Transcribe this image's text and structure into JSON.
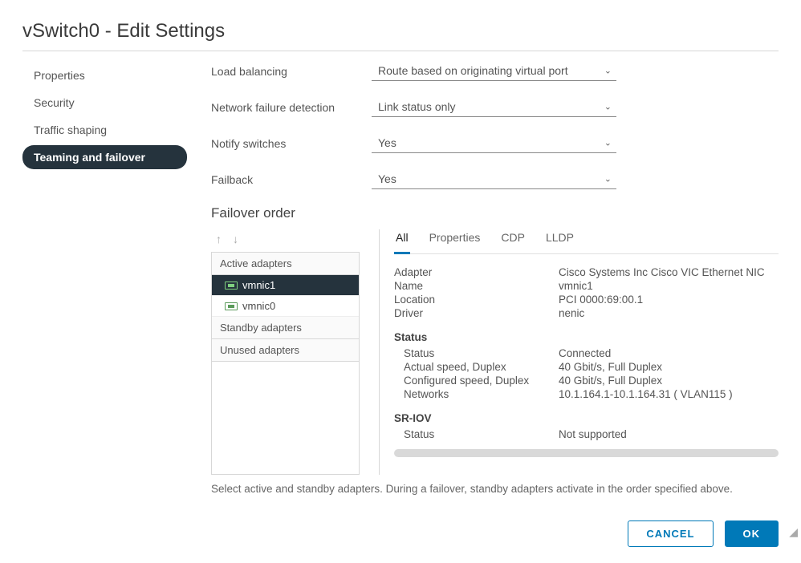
{
  "dialog": {
    "title": "vSwitch0 - Edit Settings"
  },
  "sidebar": {
    "items": [
      {
        "label": "Properties"
      },
      {
        "label": "Security"
      },
      {
        "label": "Traffic shaping"
      },
      {
        "label": "Teaming and failover"
      }
    ]
  },
  "form": {
    "load_balancing": {
      "label": "Load balancing",
      "value": "Route based on originating virtual port"
    },
    "failure_detection": {
      "label": "Network failure detection",
      "value": "Link status only"
    },
    "notify_switches": {
      "label": "Notify switches",
      "value": "Yes"
    },
    "failback": {
      "label": "Failback",
      "value": "Yes"
    }
  },
  "failover": {
    "heading": "Failover order",
    "groups": {
      "active": "Active adapters",
      "standby": "Standby adapters",
      "unused": "Unused adapters"
    },
    "active_adapters": [
      {
        "label": "vmnic1"
      },
      {
        "label": "vmnic0"
      }
    ],
    "helper": "Select active and standby adapters. During a failover, standby adapters activate in the order specified above."
  },
  "detail": {
    "tabs": [
      "All",
      "Properties",
      "CDP",
      "LLDP"
    ],
    "general": [
      {
        "k": "Adapter",
        "v": "Cisco Systems Inc Cisco VIC Ethernet NIC"
      },
      {
        "k": "Name",
        "v": "vmnic1"
      },
      {
        "k": "Location",
        "v": "PCI 0000:69:00.1"
      },
      {
        "k": "Driver",
        "v": "nenic"
      }
    ],
    "status_heading": "Status",
    "status": [
      {
        "k": "Status",
        "v": "Connected"
      },
      {
        "k": "Actual speed, Duplex",
        "v": "40 Gbit/s, Full Duplex"
      },
      {
        "k": "Configured speed, Duplex",
        "v": "40 Gbit/s, Full Duplex"
      },
      {
        "k": "Networks",
        "v": "10.1.164.1-10.1.164.31 ( VLAN115 )"
      }
    ],
    "sriov_heading": "SR-IOV",
    "sriov": [
      {
        "k": "Status",
        "v": "Not supported"
      }
    ]
  },
  "footer": {
    "cancel": "CANCEL",
    "ok": "OK"
  }
}
